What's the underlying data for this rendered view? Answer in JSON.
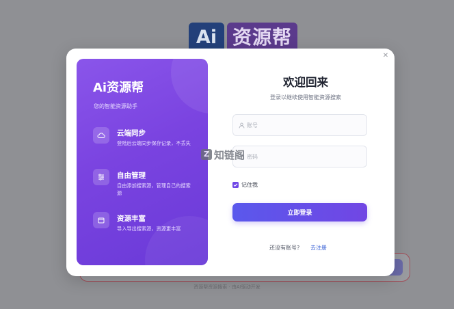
{
  "background": {
    "logo_ai": "Ai",
    "logo_text": "资源帮",
    "footer": "资源帮资源搜索 · 由AI驱动开发"
  },
  "modal": {
    "close_icon": "close-icon",
    "left_panel": {
      "title": "Ai资源帮",
      "subtitle": "您的智能资源助手",
      "features": [
        {
          "icon": "cloud-icon",
          "title": "云端同步",
          "desc": "登陆后云端同步保存记录，不丢失"
        },
        {
          "icon": "sliders-icon",
          "title": "自由管理",
          "desc": "自由添加搜索源，管理自己的搜索源"
        },
        {
          "icon": "box-icon",
          "title": "资源丰富",
          "desc": "导入导出搜索源，资源更丰富"
        }
      ]
    },
    "form": {
      "title": "欢迎回来",
      "subtitle": "登录以继续使用智能资源搜索",
      "username_placeholder": "账号",
      "password_placeholder": "密码",
      "remember_label": "记住我",
      "remember_checked": true,
      "login_button": "立即登录",
      "register_prompt": "还没有账号?",
      "register_link": "去注册"
    }
  },
  "watermark": {
    "badge": "Z",
    "text": "知链阁"
  },
  "colors": {
    "accent": "#7047e6",
    "panel_gradient_start": "#8a55ea",
    "panel_gradient_end": "#6a3ad8",
    "link": "#3a62d6",
    "overlay": "#8f9094"
  }
}
